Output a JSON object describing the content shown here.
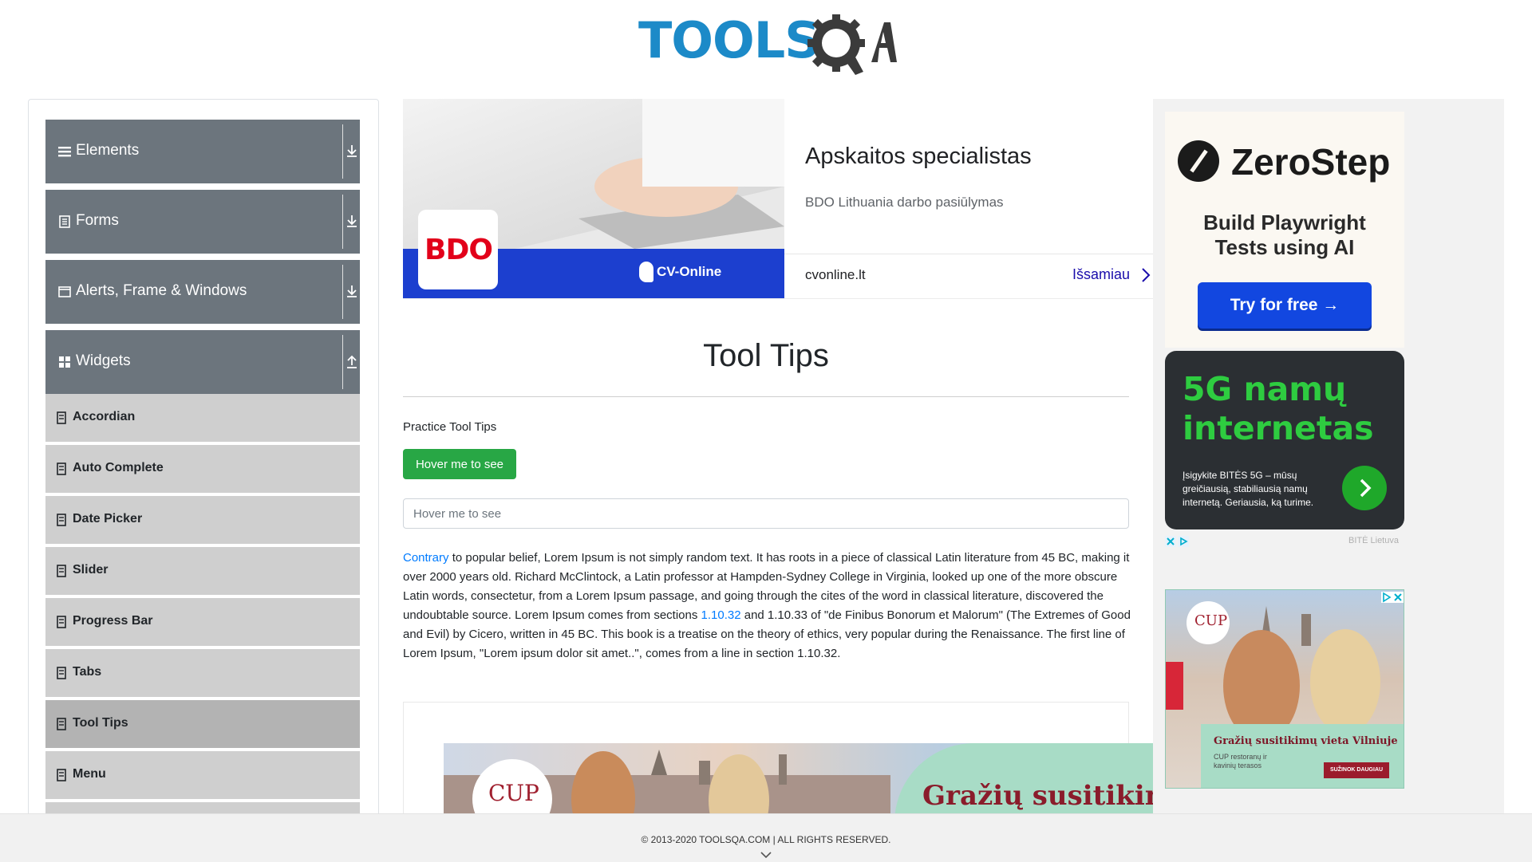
{
  "header": {
    "logo_tools": "TOOLS",
    "logo_qa": "QA"
  },
  "sidebar": {
    "groups": [
      {
        "label": "Elements",
        "icon": "hamburger-icon",
        "expanded": false
      },
      {
        "label": "Forms",
        "icon": "form-doc-icon",
        "expanded": false
      },
      {
        "label": "Alerts, Frame & Windows",
        "icon": "window-icon",
        "expanded": false
      },
      {
        "label": "Widgets",
        "icon": "widgets-grid-icon",
        "expanded": true
      }
    ],
    "items": [
      {
        "label": "Accordian",
        "active": false
      },
      {
        "label": "Auto Complete",
        "active": false
      },
      {
        "label": "Date Picker",
        "active": false
      },
      {
        "label": "Slider",
        "active": false
      },
      {
        "label": "Progress Bar",
        "active": false
      },
      {
        "label": "Tabs",
        "active": false
      },
      {
        "label": "Tool Tips",
        "active": true
      },
      {
        "label": "Menu",
        "active": false
      }
    ]
  },
  "ad_top": {
    "brand": "BDO",
    "partner": "CV-Online",
    "title": "Apskaitos specialistas",
    "subtitle": "BDO Lithuania darbo pasiūlymas",
    "domain": "cvonline.lt",
    "cta": "Išsamiau"
  },
  "main": {
    "title": "Tool Tips",
    "practice_label": "Practice Tool Tips",
    "button_label": "Hover me to see",
    "input_placeholder": "Hover me to see",
    "paragraph": {
      "link1": "Contrary",
      "text1": " to popular belief, Lorem Ipsum is not simply random text. It has roots in a piece of classical Latin literature from 45 BC, making it over 2000 years old. Richard McClintock, a Latin professor at Hampden-Sydney College in Virginia, looked up one of the more obscure Latin words, consectetur, from a Lorem Ipsum passage, and going through the cites of the word in classical literature, discovered the undoubtable source. Lorem Ipsum comes from sections ",
      "link2": "1.10.32",
      "text2": " and 1.10.33 of \"de Finibus Bonorum et Malorum\" (The Extremes of Good and Evil) by Cicero, written in 45 BC. This book is a treatise on the theory of ethics, very popular during the Renaissance. The first line of Lorem Ipsum, \"Lorem ipsum dolor sit amet..\", comes from a line in section 1.10.32."
    }
  },
  "ad_bottom": {
    "logo": "CUP",
    "headline": "Gražių susitikimų"
  },
  "ads_right": {
    "zerostep": {
      "name": "ZeroStep",
      "tagline_line1": "Build Playwright",
      "tagline_line2": "Tests using AI",
      "button": "Try for free →"
    },
    "bite": {
      "headline_line1": "5G namų",
      "headline_line2": "internetas",
      "body": "Įsigykite BITĖS 5G – mūsų greičiausią, stabiliausią namų internetą. Geriausia, ką turime.",
      "brand": "BITĖ Lietuva"
    },
    "cup": {
      "logo": "CUP",
      "title": "Gražių susitikimų vieta Vilniuje",
      "subtitle": "CUP restoranų ir kavinių terasos",
      "button": "SUŽINOK DAUGIAU"
    }
  },
  "footer": {
    "text": "© 2013-2020 TOOLSQA.COM | ALL RIGHTS RESERVED."
  },
  "colors": {
    "accent_green": "#28a745",
    "sidebar_header": "#6c757d",
    "link_blue": "#007bff",
    "logo_blue": "#1c8ac8"
  }
}
